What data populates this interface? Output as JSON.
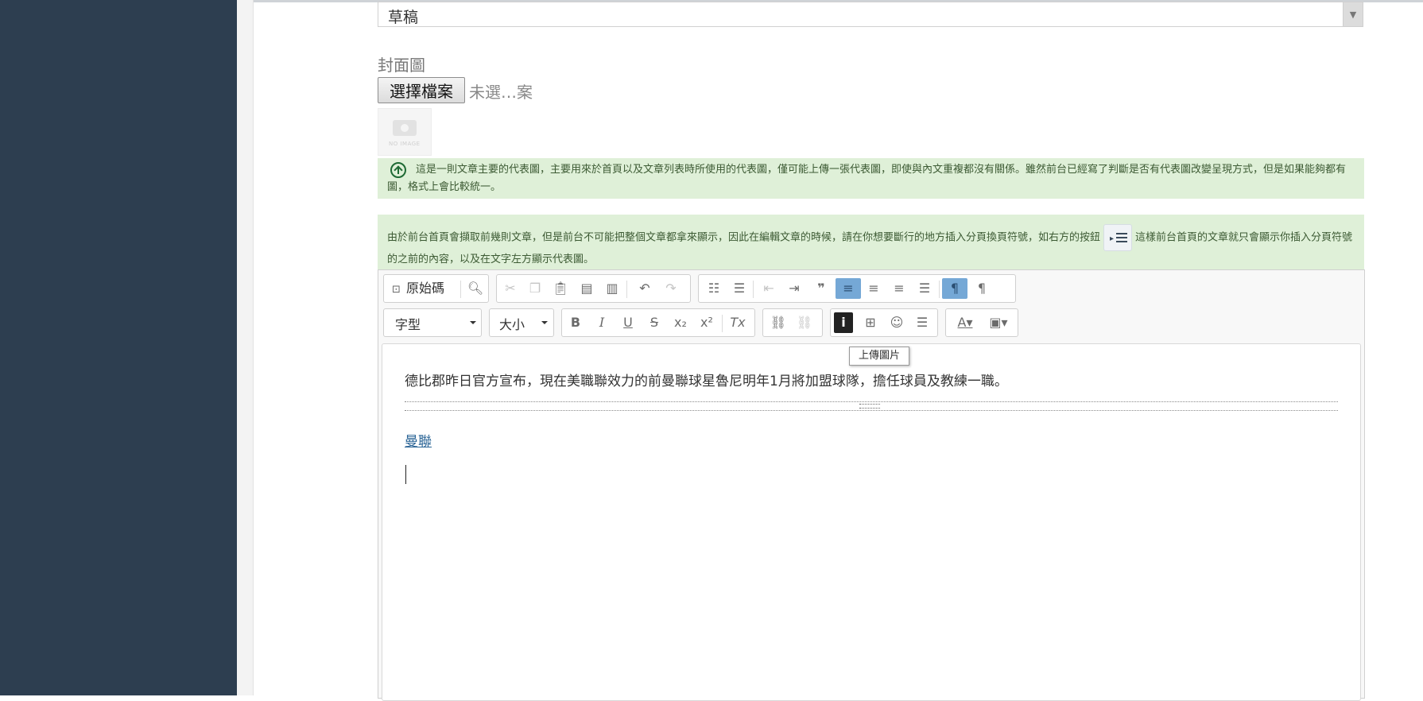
{
  "form": {
    "status_value": "草稿",
    "cover_label": "封面圖",
    "file_button": "選擇檔案",
    "file_status": "未選…案",
    "noimage_text": "NO IMAGE",
    "info_cover": "這是一則文章主要的代表圖，主要用來於首頁以及文章列表時所使用的代表圖，僅可能上傳一張代表圖，即使與內文重複都沒有關係。雖然前台已經寫了判斷是否有代表圖改變呈現方式，但是如果能夠都有圖，格式上會比較統一。",
    "info_pagebreak_a": "由於前台首頁會擷取前幾則文章，但是前台不可能把整個文章都拿來顯示，因此在編輯文章的時候，請在你想要斷行的地方插入分頁換頁符號，如右方的按鈕",
    "info_pagebreak_b": "這樣前台首頁的文章就只會顯示你插入分頁符號的之前的內容，以及在文字左方顯示代表圖。"
  },
  "editor": {
    "toolbar": {
      "source_label": "原始碼",
      "font_label": "字型",
      "size_label": "大小",
      "bold": "B",
      "italic": "I",
      "underline": "U",
      "strike": "S",
      "subscript": "x₂",
      "superscript": "x²",
      "clear_format": "Tx"
    },
    "tooltip": "上傳圖片",
    "body_text": "德比郡昨日官方宣布，現在美職聯效力的前曼聯球星魯尼明年1月將加盟球隊，擔任球員及教練一職。",
    "link_text": "曼聯"
  },
  "colors": {
    "sidebar": "#2d3e50",
    "info_bg": "#dff0d8",
    "active_button": "#75a8d6",
    "link": "#2a6496"
  }
}
